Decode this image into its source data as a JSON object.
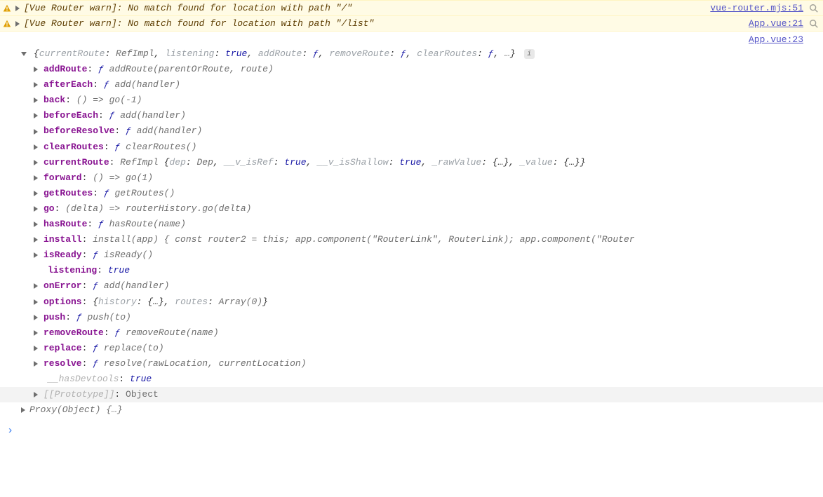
{
  "warnings": [
    {
      "message": "[Vue Router warn]: No match found for location with path \"/\"",
      "source": "vue-router.mjs:51"
    },
    {
      "message": "[Vue Router warn]: No match found for location with path \"/list\"",
      "source": "App.vue:21"
    }
  ],
  "object_source": "App.vue:23",
  "object_summary": {
    "pairs": [
      {
        "k": "currentRoute",
        "v": "RefImpl",
        "vcls": "v-gray"
      },
      {
        "k": "listening",
        "v": "true",
        "vcls": "v-blue"
      },
      {
        "k": "addRoute",
        "v": "ƒ",
        "vcls": "fsym"
      },
      {
        "k": "removeRoute",
        "v": "ƒ",
        "vcls": "fsym"
      },
      {
        "k": "clearRoutes",
        "v": "ƒ",
        "vcls": "fsym"
      }
    ],
    "ellipsis": "…"
  },
  "props": {
    "addRoute": {
      "kind": "fn",
      "text": "ƒ addRoute(parentOrRoute, route)"
    },
    "afterEach": {
      "kind": "fn",
      "text": "ƒ add(handler)"
    },
    "back": {
      "kind": "expr",
      "text": "() => go(-1)"
    },
    "beforeEach": {
      "kind": "fn",
      "text": "ƒ add(handler)"
    },
    "beforeResolve": {
      "kind": "fn",
      "text": "ƒ add(handler)"
    },
    "clearRoutes": {
      "kind": "fn",
      "text": "ƒ clearRoutes()"
    },
    "currentRoute": {
      "kind": "obj",
      "cls": "RefImpl",
      "inner": [
        {
          "k": "dep",
          "v": "Dep",
          "cls": "v-gray",
          "dim": true
        },
        {
          "k": "__v_isRef",
          "v": "true",
          "cls": "v-blue",
          "dim": true
        },
        {
          "k": "__v_isShallow",
          "v": "true",
          "cls": "v-blue",
          "dim": true
        },
        {
          "k": "_rawValue",
          "v": "{…}",
          "cls": "curly",
          "dim": true
        },
        {
          "k": "_value",
          "v": "{…}",
          "cls": "curly",
          "dim": true
        }
      ]
    },
    "forward": {
      "kind": "expr",
      "text": "() => go(1)"
    },
    "getRoutes": {
      "kind": "fn",
      "text": "ƒ getRoutes()"
    },
    "go": {
      "kind": "expr",
      "text": "(delta) => routerHistory.go(delta)"
    },
    "hasRoute": {
      "kind": "fn",
      "text": "ƒ hasRoute(name)"
    },
    "install": {
      "kind": "expr",
      "text": "install(app) { const router2 = this; app.component(\"RouterLink\", RouterLink); app.component(\"Router"
    },
    "isReady": {
      "kind": "fn",
      "text": "ƒ isReady()"
    },
    "listening": {
      "kind": "val",
      "text": "true",
      "noarrow": true
    },
    "onError": {
      "kind": "fn",
      "text": "ƒ add(handler)"
    },
    "options": {
      "kind": "obj",
      "inner": [
        {
          "k": "history",
          "v": "{…}",
          "cls": "curly",
          "dim": true
        },
        {
          "k": "routes",
          "v": "Array(0)",
          "cls": "v-gray",
          "dim": true
        }
      ]
    },
    "push": {
      "kind": "fn",
      "text": "ƒ push(to)"
    },
    "removeRoute": {
      "kind": "fn",
      "text": "ƒ removeRoute(name)"
    },
    "replace": {
      "kind": "fn",
      "text": "ƒ replace(to)"
    },
    "resolve": {
      "kind": "fn",
      "text": "ƒ resolve(rawLocation, currentLocation)"
    },
    "__hasDevtools": {
      "kind": "val",
      "text": "true",
      "noarrow": true,
      "dimkey": true
    },
    "[[Prototype]]": {
      "kind": "plain",
      "text": "Object",
      "dimkey": true,
      "hover": true
    }
  },
  "proxy_line": "Proxy(Object) {…}",
  "prompt": "›"
}
